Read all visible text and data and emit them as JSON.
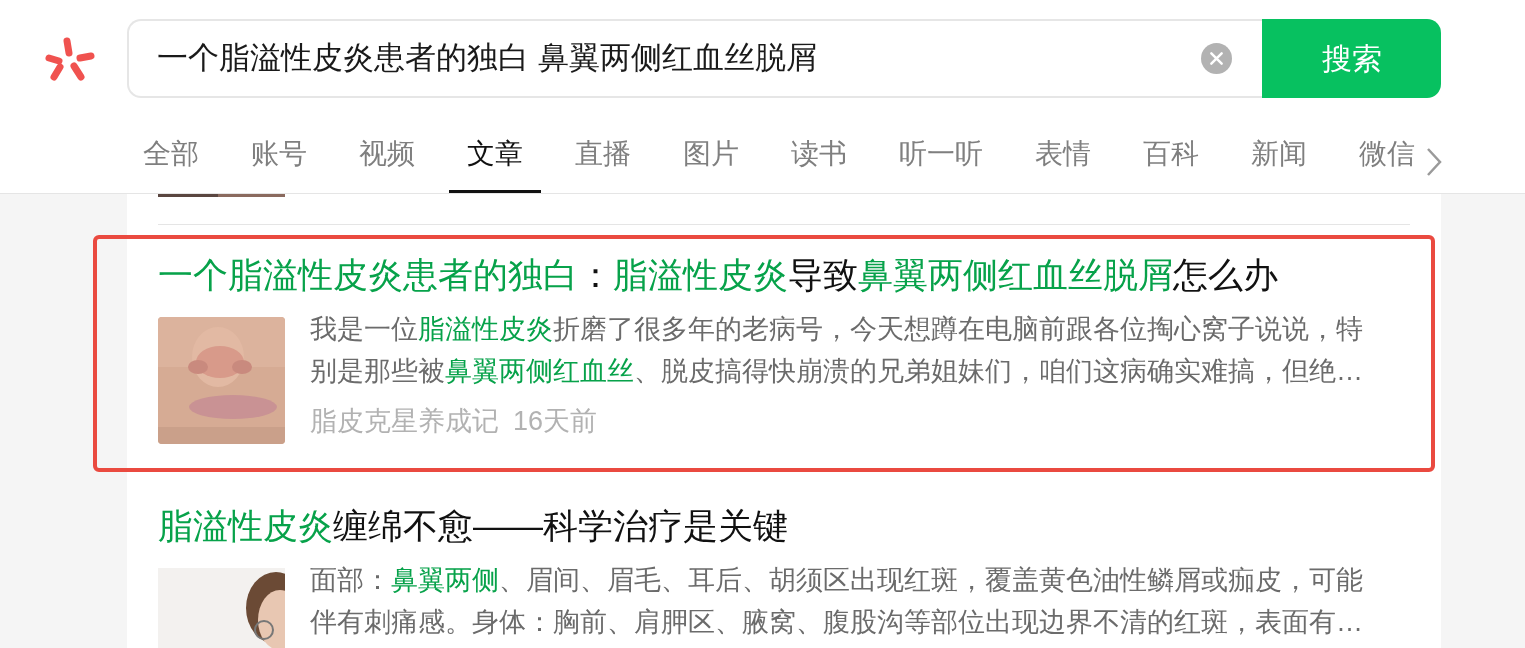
{
  "search": {
    "value": "一个脂溢性皮炎患者的独白 鼻翼两侧红血丝脱屑",
    "button": "搜索"
  },
  "tabs": [
    {
      "label": "全部",
      "selected": false
    },
    {
      "label": "账号",
      "selected": false
    },
    {
      "label": "视频",
      "selected": false
    },
    {
      "label": "文章",
      "selected": true
    },
    {
      "label": "直播",
      "selected": false
    },
    {
      "label": "图片",
      "selected": false
    },
    {
      "label": "读书",
      "selected": false
    },
    {
      "label": "听一听",
      "selected": false
    },
    {
      "label": "表情",
      "selected": false
    },
    {
      "label": "百科",
      "selected": false
    },
    {
      "label": "新闻",
      "selected": false
    },
    {
      "label": "微信",
      "selected": false
    }
  ],
  "results": [
    {
      "marked": true,
      "title": [
        {
          "text": "一个脂溢性皮炎患者的独白",
          "highlight": true
        },
        {
          "text": "：",
          "highlight": false
        },
        {
          "text": "脂溢性皮炎",
          "highlight": true
        },
        {
          "text": "导致",
          "highlight": false
        },
        {
          "text": "鼻翼两侧红血丝脱屑",
          "highlight": true
        },
        {
          "text": "怎么办",
          "highlight": false
        }
      ],
      "snippet": [
        [
          {
            "text": "我是一位",
            "highlight": false
          },
          {
            "text": "脂溢性皮炎",
            "highlight": true
          },
          {
            "text": "折磨了很多年的老病号，今天想蹲在电脑前跟各位掏心窝子说说，特",
            "highlight": false
          }
        ],
        [
          {
            "text": "别是那些被",
            "highlight": false
          },
          {
            "text": "鼻翼两侧红血丝",
            "highlight": true
          },
          {
            "text": "、脱皮搞得快崩溃的兄弟姐妹们，咱们这病确实难搞，但绝…",
            "highlight": false
          }
        ]
      ],
      "source": "脂皮克星养成记",
      "time": "16天前"
    },
    {
      "marked": false,
      "title": [
        {
          "text": "脂溢性皮炎",
          "highlight": true
        },
        {
          "text": "缠绵不愈——科学治疗是关键",
          "highlight": false
        }
      ],
      "snippet": [
        [
          {
            "text": "面部：",
            "highlight": false
          },
          {
            "text": "鼻翼两侧",
            "highlight": true
          },
          {
            "text": "、眉间、眉毛、耳后、胡须区出现红斑，覆盖黄色油性鳞屑或痂皮，可能",
            "highlight": false
          }
        ],
        [
          {
            "text": "伴有刺痛感。身体：胸前、肩胛区、腋窝、腹股沟等部位出现边界不清的红斑，表面有…",
            "highlight": false
          }
        ]
      ]
    }
  ]
}
